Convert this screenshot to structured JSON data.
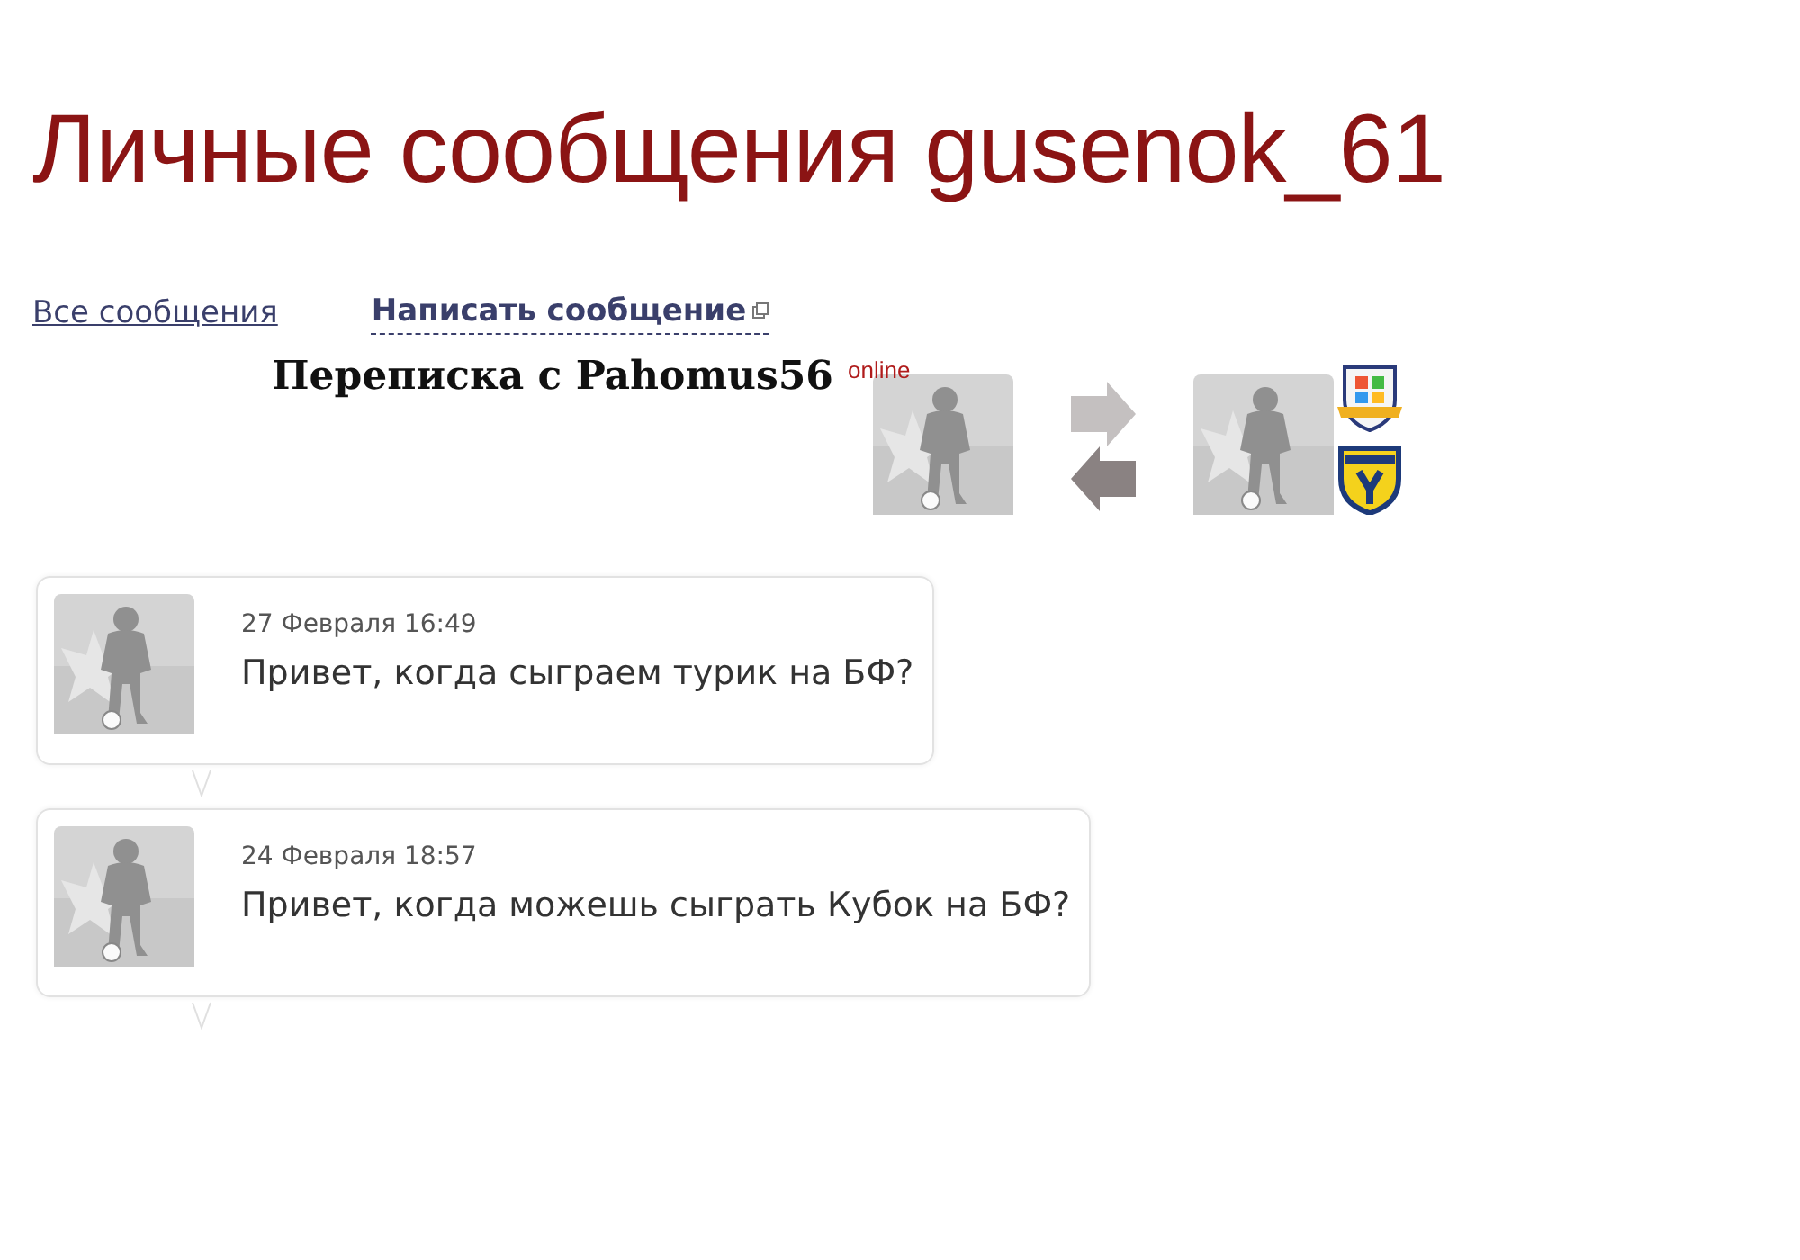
{
  "title": "Личные сообщения gusenok_61",
  "nav": [
    {
      "label": "Все сообщения",
      "kind": "plain"
    },
    {
      "label": "Написать сообщение",
      "kind": "popup"
    }
  ],
  "conversation": {
    "heading": "Переписка с Pahomus56",
    "status": "online"
  },
  "messages": [
    {
      "date": "27 Февраля 16:49",
      "text": "Привет, когда сыграем турик на БФ?"
    },
    {
      "date": "24 Февраля 18:57",
      "text": "Привет, когда можешь сыграть Кубок на БФ?"
    }
  ]
}
